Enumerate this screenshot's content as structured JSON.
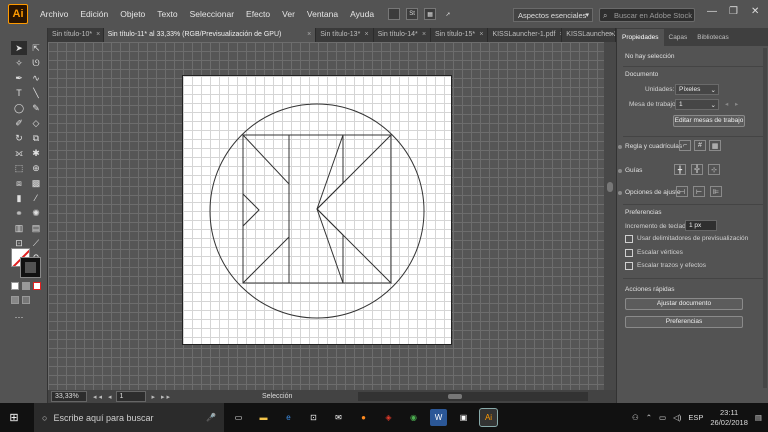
{
  "app": {
    "logo": "Ai"
  },
  "menu": [
    "Archivo",
    "Edición",
    "Objeto",
    "Texto",
    "Seleccionar",
    "Efecto",
    "Ver",
    "Ventana",
    "Ayuda"
  ],
  "menubar_tools": {
    "st_label": "St"
  },
  "workspace": {
    "label": "Aspectos esenciales"
  },
  "stock_search": {
    "placeholder": "Buscar en Adobe Stock"
  },
  "window_controls": {
    "minimize": "—",
    "maximize": "❐",
    "close": "✕"
  },
  "tabs": [
    {
      "label": "Sin título-10*",
      "close": "×",
      "active": false
    },
    {
      "label": "Sin título-11* al 33,33% (RGB/Previsualización de GPU)",
      "close": "×",
      "active": true
    },
    {
      "label": "Sin título-13*",
      "close": "×",
      "active": false
    },
    {
      "label": "Sin título-14*",
      "close": "×",
      "active": false
    },
    {
      "label": "Sin título-15*",
      "close": "×",
      "active": false
    },
    {
      "label": "KISSLauncher-1.pdf",
      "close": "×",
      "active": false
    },
    {
      "label": "KISSLauncher-2.",
      "close": "",
      "active": false
    }
  ],
  "tab_overflow": "»",
  "status": {
    "zoom": "33,33%",
    "page": "1",
    "tool": "Selección",
    "nav": "◂◂ ◂",
    "nav_next": "▸ ▸▸"
  },
  "right_panel": {
    "tabs": [
      "Propiedades",
      "Capas",
      "Bibliotecas"
    ],
    "no_selection": "No hay selección",
    "documento": "Documento",
    "unidades_label": "Unidades:",
    "unidades_value": "Píxeles",
    "mesa_label": "Mesa de trabajo:",
    "mesa_value": "1",
    "edit_artboards": "Editar mesas de trabajo",
    "regla": "Regla y cuadrículas",
    "guias": "Guías",
    "opciones_ajuste": "Opciones de ajuste",
    "preferencias": "Preferencias",
    "incremento_label": "Incremento de teclado:",
    "incremento_value": "1 px",
    "chk1": "Usar delimitadores de previsualización",
    "chk2": "Escalar vértices",
    "chk3": "Escalar trazos y efectos",
    "acciones": "Acciones rápidas",
    "ajustar": "Ajustar documento",
    "prefs_btn": "Preferencias"
  },
  "taskbar": {
    "search_placeholder": "Escribe aquí para buscar",
    "lang": "ESP",
    "time": "23:11",
    "date": "26/02/2018",
    "icons": [
      "task-view-icon",
      "file-explorer-icon",
      "edge-icon",
      "store-icon",
      "mail-icon",
      "firefox-icon",
      "acrobat-icon",
      "chrome-icon",
      "word-icon",
      "photos-icon",
      "illustrator-icon"
    ],
    "ai_label": "Ai",
    "word_label": "W"
  }
}
